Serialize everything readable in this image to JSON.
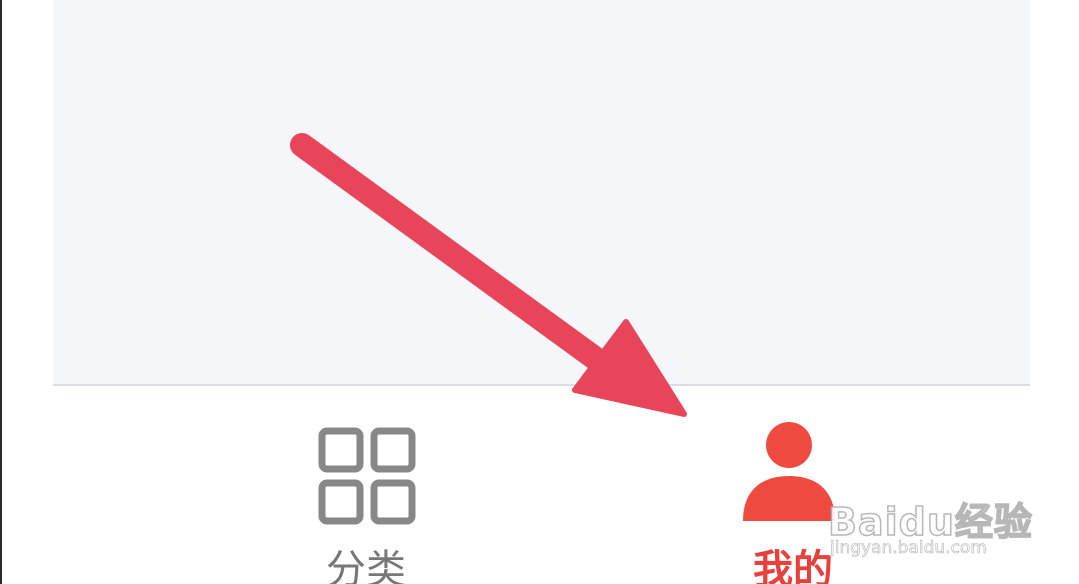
{
  "tabbar": {
    "tabs": [
      {
        "label": "分类",
        "icon": "grid-icon",
        "active": false,
        "color": "#777777"
      },
      {
        "label": "我的",
        "icon": "person-icon",
        "active": true,
        "color": "#e8403b"
      }
    ]
  },
  "overlay": {
    "arrow_color": "#e8455a",
    "arrow_icon": "arrow-pointer-icon"
  },
  "watermark": {
    "logo": "Baidu经验",
    "url": "jingyan.baidu.com"
  },
  "colors": {
    "content_background": "#f4f6f9",
    "active_accent": "#e8403b",
    "inactive_icon": "#888888"
  }
}
